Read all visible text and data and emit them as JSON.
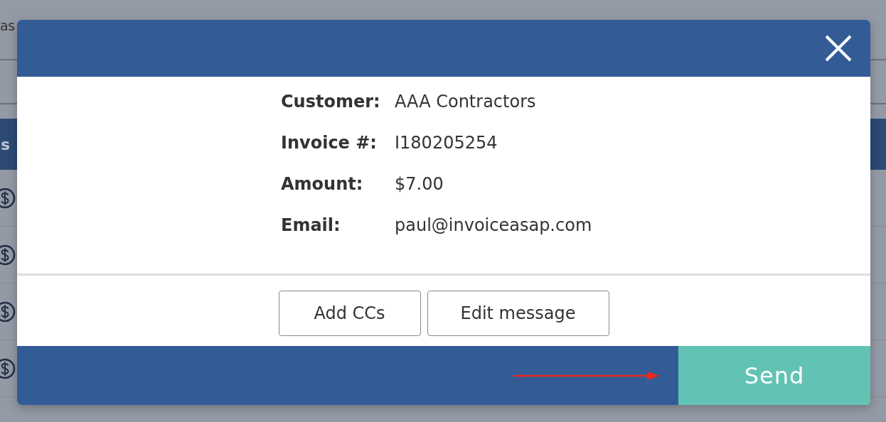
{
  "background": {
    "heading_fragment": "as",
    "table_header_fragment": "s"
  },
  "modal": {
    "details": [
      {
        "label": "Customer:",
        "value": "AAA Contractors"
      },
      {
        "label": "Invoice #:",
        "value": "I180205254"
      },
      {
        "label": "Amount:",
        "value": "$7.00"
      },
      {
        "label": "Email:",
        "value": "paul@invoiceasap.com"
      }
    ],
    "buttons": [
      "Add CCs",
      "Edit message"
    ],
    "send": "Send"
  }
}
